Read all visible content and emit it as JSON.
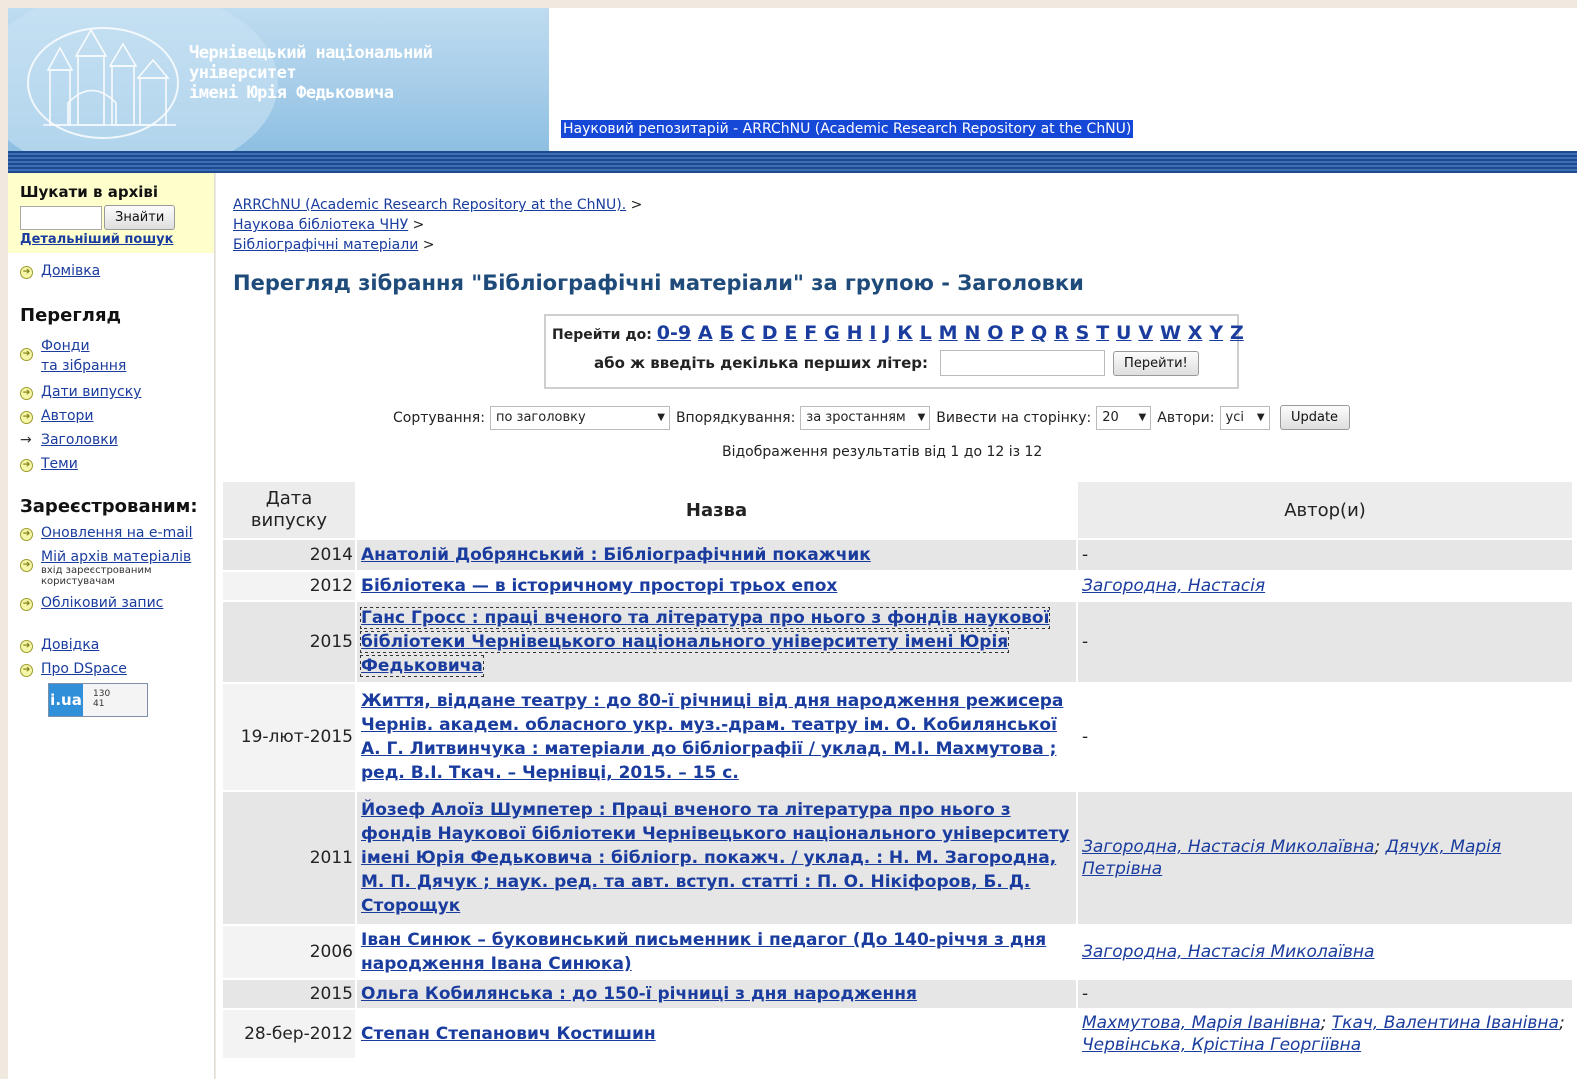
{
  "header": {
    "university_line1": "Чернівецький національний університет",
    "university_line2": "імені Юрія Федьковича",
    "repository_link": "Науковий репозитарій - ARRChNU (Academic Research Repository at the ChNU)"
  },
  "sidebar": {
    "search_heading": "Шукати в архіві",
    "search_button": "Знайти",
    "advanced_search": "Детальніший пошук",
    "home": "Домівка",
    "browse_heading": "Перегляд",
    "browse_items": [
      {
        "label_line1": "Фонди",
        "label_line2": "та зібрання"
      },
      {
        "label_line1": "Дати випуску"
      },
      {
        "label_line1": "Автори"
      },
      {
        "label_line1": "Заголовки"
      },
      {
        "label_line1": "Теми"
      }
    ],
    "registered_heading": "Зареєстрованим:",
    "email_updates": "Оновлення на e-mail",
    "my_archive": "Мій архів матеріалів",
    "my_archive_note_line1": "вхід зареєстрованим",
    "my_archive_note_line2": "користувачам",
    "account": "Обліковий запис",
    "help": "Довідка",
    "about": "Про DSpace",
    "counter_logo": "i.ua",
    "counter_num1": "130",
    "counter_num2": "41"
  },
  "breadcrumb": [
    "ARRChNU (Academic Research Repository at the ChNU).",
    "Наукова бібліотека ЧНУ",
    "Бібліографічні матеріали"
  ],
  "breadcrumb_separator": ">",
  "page_title": "Перегляд зібрання \"Бібліографічні матеріали\" за групою - Заголовки",
  "jump": {
    "label": "Перейти до:",
    "letters": [
      "0-9",
      "А",
      "Б",
      "С",
      "D",
      "Е",
      "F",
      "G",
      "Н",
      "I",
      "J",
      "К",
      "L",
      "М",
      "N",
      "О",
      "Р",
      "Q",
      "R",
      "S",
      "Т",
      "U",
      "V",
      "W",
      "X",
      "Y",
      "Z"
    ],
    "or_enter_label": "або ж введіть декілька перших літер:",
    "go_button": "Перейти!"
  },
  "sort": {
    "sort_label": "Сортування:",
    "sort_value": "по заголовку",
    "order_label": "Впорядкування:",
    "order_value": "за зростанням",
    "per_page_label": "Вивести на сторінку:",
    "per_page_value": "20",
    "authors_label": "Автори:",
    "authors_value": "усі",
    "update_button": "Update"
  },
  "results_info": "Відображення результатів від 1 до 12 із 12",
  "table": {
    "headers": {
      "date_line1": "Дата",
      "date_line2": "випуску",
      "title": "Назва",
      "authors": "Автор(и)"
    },
    "rows": [
      {
        "date": "2014",
        "title": "Анатолій Добрянський : Бібліографічний покажчик",
        "authors": [],
        "authors_text": "-"
      },
      {
        "date": "2012",
        "title": "Бібліотека — в історичному просторі трьох епох",
        "authors": [
          "Загородна, Настасія"
        ],
        "authors_text": ""
      },
      {
        "date": "2015",
        "title": "Ганс Гросс : праці вченого та література про нього з фондів наукової бібліотеки Чернівецького національного університету імені Юрія Федьковича",
        "authors": [],
        "authors_text": "-"
      },
      {
        "date": "19-лют-2015",
        "title": "Життя, віддане театру : до 80-ї річниці від дня народження режисера Чернів. академ. обласного укр. муз.-драм. театру ім. О. Кобилянської А. Г. Литвинчука : матеріали до бібліографії / уклад. М.І. Махмутова ; ред. В.І. Ткач. – Чернівці, 2015. – 15 с.",
        "authors": [],
        "authors_text": "-"
      },
      {
        "date": "2011",
        "title": "Йозеф Алоїз Шумпетер : Праці вченого та література про нього з фондів Наукової бібліотеки Чернівецького національного університету імені Юрія Федьковича : бібліогр. покажч. / уклад. : Н. М. Загородна, М. П. Дячук ; наук. ред. та авт. вступ. статті : П. О. Нікіфоров, Б. Д. Сторощук",
        "authors": [
          "Загородна, Настасія Миколаївна",
          "Дячук, Марія Петрівна"
        ],
        "authors_text": ""
      },
      {
        "date": "2006",
        "title": "Іван Синюк – буковинський письменник і педагог (До 140-річчя з дня народження Івана Синюка)",
        "authors": [
          "Загородна, Настасія Миколаївна"
        ],
        "authors_text": ""
      },
      {
        "date": "2015",
        "title": "Ольга Кобилянська : до 150-ї річниці з дня народження",
        "authors": [],
        "authors_text": "-"
      },
      {
        "date": "28-бер-2012",
        "title": "Степан Степанович Костишин",
        "authors": [
          "Махмутова, Марія Іванівна",
          "Ткач, Валентина Іванівна",
          "Червінська, Крістіна Георгіївна"
        ],
        "authors_text": ""
      }
    ]
  },
  "colors": {
    "link": "#1a3c9e",
    "title": "#1f4b7a",
    "header_link_bg": "#1648d8",
    "search_box_bg": "#ffffcc",
    "row_shade": "#e6e6e6"
  }
}
